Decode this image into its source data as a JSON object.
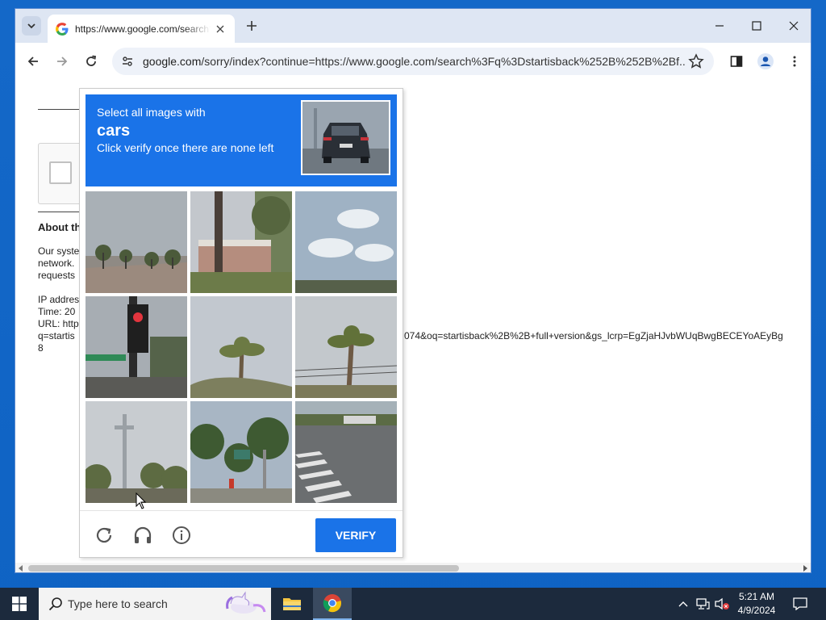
{
  "browser": {
    "tab_title": "https://www.google.com/search?q=startisback",
    "url_prefix": "google.com",
    "url_rest": "/sorry/index?continue=https://www.google.com/search%3Fq%3Dstartisback%252B%252B%2Bf..."
  },
  "page": {
    "heading": "About th",
    "para_lines": [
      "Our syste",
      "network.",
      "requests"
    ],
    "ip_line": "IP addres",
    "time_line": "Time: 20",
    "url_line": "URL: http",
    "q_line": "q=startis",
    "url_tail": "074&oq=startisback%2B%2B+full+version&gs_lcrp=EgZjaHJvbWUqBwgBECEYoAEyBg",
    "last_line": "8"
  },
  "captcha": {
    "instruction_line1": "Select all images with",
    "target": "cars",
    "instruction_line3": "Click verify once there are none left",
    "verify_label": "VERIFY",
    "tiles": [
      "palm-trees-rooftop",
      "pole-and-building",
      "sky-clouds",
      "traffic-light",
      "palm-tree-sky",
      "palm-tree-wires",
      "street-pole-trees",
      "trees-road-sign",
      "crosswalk"
    ]
  },
  "taskbar": {
    "search_placeholder": "Type here to search",
    "time": "5:21 AM",
    "date": "4/9/2024"
  },
  "colors": {
    "captcha_blue": "#1a73e8",
    "taskbar": "#1c2a3d"
  }
}
